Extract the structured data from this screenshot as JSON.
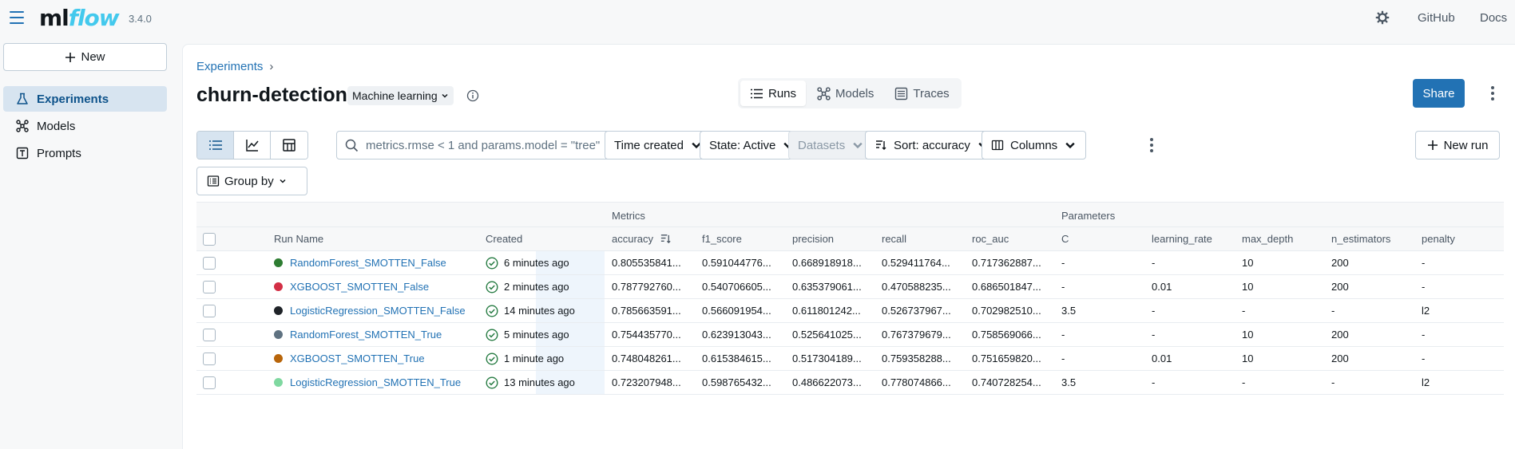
{
  "app": {
    "version": "3.4.0",
    "logo_ml": "ml",
    "logo_flow": "flow",
    "links": {
      "github": "GitHub",
      "docs": "Docs"
    }
  },
  "sidebar": {
    "new_label": "New",
    "items": [
      {
        "label": "Experiments",
        "icon": "beaker-icon",
        "active": true
      },
      {
        "label": "Models",
        "icon": "models-icon",
        "active": false
      },
      {
        "label": "Prompts",
        "icon": "prompt-icon",
        "active": false
      }
    ]
  },
  "header": {
    "breadcrumb": "Experiments",
    "breadcrumb_sep": "›",
    "title": "churn-detection",
    "type_label": "Machine learning",
    "share_label": "Share",
    "tabs": [
      {
        "label": "Runs",
        "icon": "list-icon",
        "active": true
      },
      {
        "label": "Models",
        "icon": "models-icon",
        "active": false
      },
      {
        "label": "Traces",
        "icon": "traces-icon",
        "active": false
      }
    ]
  },
  "toolbar": {
    "search_placeholder": "metrics.rmse < 1 and params.model = \"tree\"",
    "time_created": "Time created",
    "state": "State: Active",
    "datasets": "Datasets",
    "sort": "Sort: accuracy",
    "columns": "Columns",
    "new_run": "New run",
    "group_by": "Group by"
  },
  "table": {
    "groups": {
      "metrics": "Metrics",
      "parameters": "Parameters"
    },
    "headers": [
      "Run Name",
      "Created",
      "accuracy",
      "f1_score",
      "precision",
      "recall",
      "roc_auc",
      "C",
      "learning_rate",
      "max_depth",
      "n_estimators",
      "penalty"
    ],
    "rows": [
      {
        "name": "RandomForest_SMOTTEN_False",
        "color": "#2e7d32",
        "created": "6 minutes ago",
        "accuracy": "0.805535841...",
        "f1_score": "0.591044776...",
        "precision": "0.668918918...",
        "recall": "0.529411764...",
        "roc_auc": "0.717362887...",
        "C": "-",
        "learning_rate": "-",
        "max_depth": "10",
        "n_estimators": "200",
        "penalty": "-"
      },
      {
        "name": "XGBOOST_SMOTTEN_False",
        "color": "#d32f45",
        "created": "2 minutes ago",
        "accuracy": "0.787792760...",
        "f1_score": "0.540706605...",
        "precision": "0.635379061...",
        "recall": "0.470588235...",
        "roc_auc": "0.686501847...",
        "C": "-",
        "learning_rate": "0.01",
        "max_depth": "10",
        "n_estimators": "200",
        "penalty": "-"
      },
      {
        "name": "LogisticRegression_SMOTTEN_False",
        "color": "#1f2328",
        "created": "14 minutes ago",
        "accuracy": "0.785663591...",
        "f1_score": "0.566091954...",
        "precision": "0.611801242...",
        "recall": "0.526737967...",
        "roc_auc": "0.702982510...",
        "C": "3.5",
        "learning_rate": "-",
        "max_depth": "-",
        "n_estimators": "-",
        "penalty": "l2"
      },
      {
        "name": "RandomForest_SMOTTEN_True",
        "color": "#5f7281",
        "created": "5 minutes ago",
        "accuracy": "0.754435770...",
        "f1_score": "0.623913043...",
        "precision": "0.525641025...",
        "recall": "0.767379679...",
        "roc_auc": "0.758569066...",
        "C": "-",
        "learning_rate": "-",
        "max_depth": "10",
        "n_estimators": "200",
        "penalty": "-"
      },
      {
        "name": "XGBOOST_SMOTTEN_True",
        "color": "#b8650a",
        "created": "1 minute ago",
        "accuracy": "0.748048261...",
        "f1_score": "0.615384615...",
        "precision": "0.517304189...",
        "recall": "0.759358288...",
        "roc_auc": "0.751659820...",
        "C": "-",
        "learning_rate": "0.01",
        "max_depth": "10",
        "n_estimators": "200",
        "penalty": "-"
      },
      {
        "name": "LogisticRegression_SMOTTEN_True",
        "color": "#7fd8a0",
        "created": "13 minutes ago",
        "accuracy": "0.723207948...",
        "f1_score": "0.598765432...",
        "precision": "0.486622073...",
        "recall": "0.778074866...",
        "roc_auc": "0.740728254...",
        "C": "3.5",
        "learning_rate": "-",
        "max_depth": "-",
        "n_estimators": "-",
        "penalty": "l2"
      }
    ]
  },
  "colors": {
    "accent": "#2272b4",
    "sidebar_active": "#d7e4f0",
    "success": "#277c43"
  }
}
